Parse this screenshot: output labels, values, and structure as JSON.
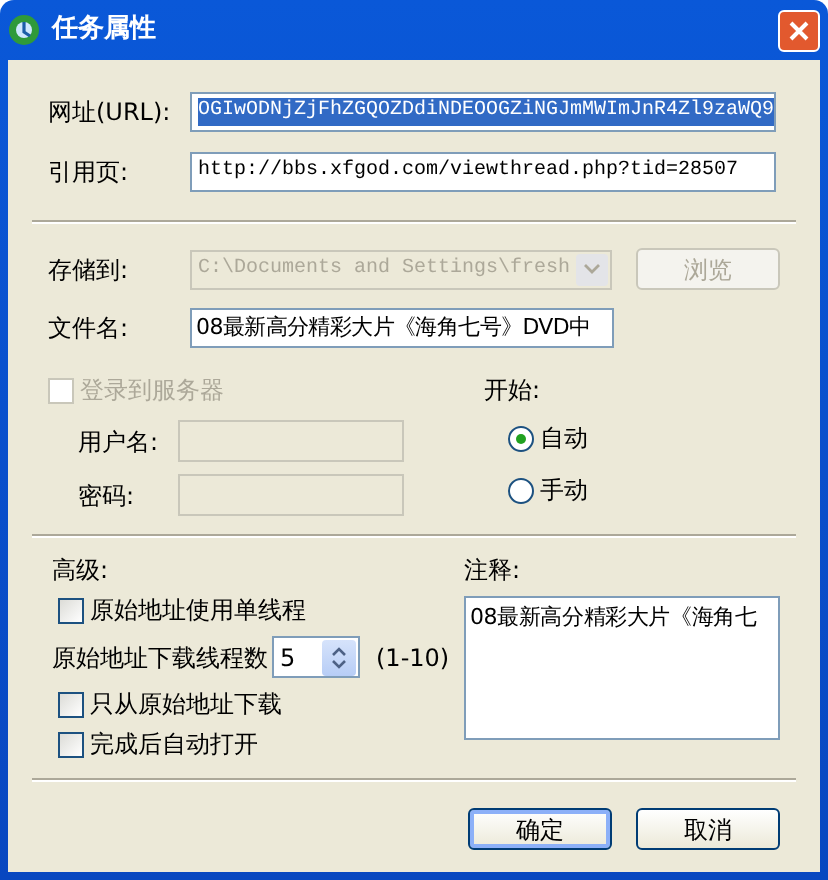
{
  "window": {
    "title": "任务属性"
  },
  "fields": [
    {
      "label": "网址(URL):",
      "value": "OGIwODNjZjFhZGQOZDdiNDEOOGZiNGJmMWImJnR4Zl9zaWQ9",
      "text_selected": true
    },
    {
      "label": "引用页:",
      "value": "http://bbs.xfgod.com/viewthread.php?tid=28507",
      "text_selected": false
    }
  ],
  "save_to": {
    "label": "存储到:",
    "value": "C:\\Documents and Settings\\fresh",
    "disabled": true,
    "browse_button": {
      "label": "浏览",
      "disabled": true
    }
  },
  "filename": {
    "label": "文件名:",
    "value": "08最新高分精彩大片《海角七号》DVD中"
  },
  "login": {
    "label": "登录到服务器",
    "checked": false,
    "disabled": true,
    "username_label": "用户名:",
    "password_label": "密码:"
  },
  "start": {
    "label": "开始:",
    "options": [
      {
        "label": "自动",
        "selected": true
      },
      {
        "label": "手动",
        "selected": false
      }
    ]
  },
  "advanced": {
    "label": "高级:",
    "options": [
      {
        "kind": "checkbox",
        "label": "原始地址使用单线程",
        "checked": false
      },
      {
        "kind": "spinner",
        "label": "原始地址下载线程数",
        "value": "5",
        "hint": "(1-10)"
      },
      {
        "kind": "checkbox",
        "label": "只从原始地址下载",
        "checked": false
      },
      {
        "kind": "checkbox",
        "label": "完成后自动打开",
        "checked": false
      }
    ]
  },
  "notes": {
    "label": "注释:",
    "value": "08最新高分精彩大片《海角七"
  },
  "buttons": [
    {
      "label": "确定",
      "default": true
    },
    {
      "label": "取消",
      "default": false
    }
  ]
}
